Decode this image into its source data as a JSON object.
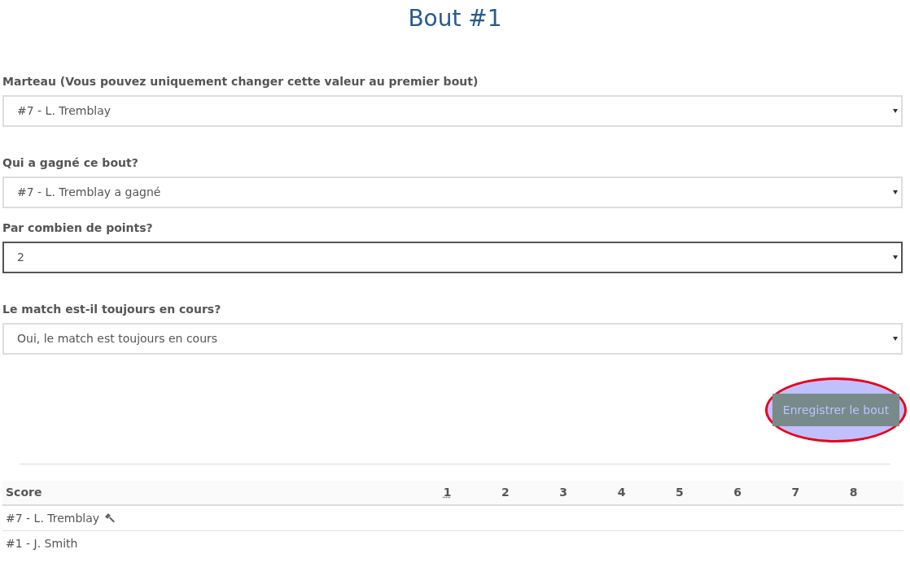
{
  "title": "Bout #1",
  "fields": [
    {
      "label": "Marteau (Vous pouvez uniquement changer cette valeur au premier bout)",
      "value": "#7 - L. Tremblay",
      "focused": false
    },
    {
      "label": "Qui a gagné ce bout?",
      "value": "#7 - L. Tremblay a gagné",
      "focused": false
    },
    {
      "label": "Par combien de points?",
      "value": "2",
      "focused": true
    },
    {
      "label": "Le match est-il toujours en cours?",
      "value": "Oui, le match est toujours en cours",
      "focused": false
    }
  ],
  "save_button": {
    "label": "Enregistrer le bout",
    "highlighted": true
  },
  "score_table": {
    "columns": [
      {
        "label": "Score",
        "abbr": false
      },
      {
        "label": "1",
        "abbr": true
      },
      {
        "label": "2",
        "abbr": false
      },
      {
        "label": "3",
        "abbr": false
      },
      {
        "label": "4",
        "abbr": false
      },
      {
        "label": "5",
        "abbr": false
      },
      {
        "label": "6",
        "abbr": false
      },
      {
        "label": "7",
        "abbr": false
      },
      {
        "label": "8",
        "abbr": false
      }
    ],
    "rows": [
      {
        "team": "#7 - L. Tremblay",
        "hammer": true
      },
      {
        "team": "#1 - J. Smith",
        "hammer": false
      }
    ]
  }
}
